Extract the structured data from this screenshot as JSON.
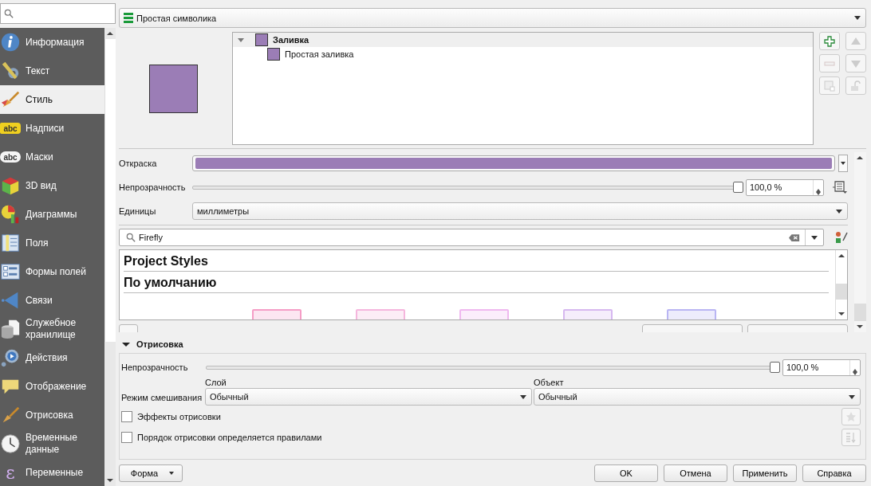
{
  "sidebar": {
    "items": [
      {
        "label": "Информация",
        "selected": false
      },
      {
        "label": "Текст",
        "selected": false
      },
      {
        "label": "Стиль",
        "selected": true
      },
      {
        "label": "Надписи",
        "selected": false,
        "badge": "abc"
      },
      {
        "label": "Маски",
        "selected": false,
        "badge": "abc"
      },
      {
        "label": "3D вид",
        "selected": false
      },
      {
        "label": "Диаграммы",
        "selected": false
      },
      {
        "label": "Поля",
        "selected": false
      },
      {
        "label": "Формы полей",
        "selected": false
      },
      {
        "label": "Связи",
        "selected": false
      },
      {
        "label": "Служебное хранилище",
        "selected": false
      },
      {
        "label": "Действия",
        "selected": false
      },
      {
        "label": "Отображение",
        "selected": false
      },
      {
        "label": "Отрисовка",
        "selected": false
      },
      {
        "label": "Временные данные",
        "selected": false
      },
      {
        "label": "Переменные",
        "selected": false,
        "badge": "ε"
      }
    ]
  },
  "renderer": {
    "value": "Простая символика"
  },
  "symbol_tree": {
    "expanded": true,
    "label": "Заливка",
    "children": [
      {
        "label": "Простая заливка"
      }
    ]
  },
  "properties": {
    "color_label": "Откраска",
    "opacity_label": "Непрозрачность",
    "opacity": {
      "level": 1
    },
    "opacity_value": "100,0 %",
    "units_label": "Единицы",
    "units_value": "миллиметры"
  },
  "style_library": {
    "search_value": "Firefly",
    "groups": [
      "Project Styles",
      "По умолчанию"
    ],
    "swatches": [
      {
        "color": "#f59dc6"
      },
      {
        "color": "#f5b6dd"
      },
      {
        "color": "#efb8ef"
      },
      {
        "color": "#d6b8f0"
      },
      {
        "color": "#b9b5f3"
      }
    ]
  },
  "rendering": {
    "title": "Отрисовка",
    "expanded": true,
    "opacity_label": "Непрозрачность",
    "opacity": {
      "level": 1
    },
    "opacity_value": "100,0 %",
    "blend_label": "Режим смешивания",
    "layer_label": "Слой",
    "layer_value": "Обычный",
    "object_label": "Объект",
    "object_value": "Обычный",
    "checks": [
      {
        "label": "Эффекты отрисовки",
        "checked": false
      },
      {
        "label": "Порядок отрисовки определяется правилами",
        "checked": false
      }
    ]
  },
  "buttons": {
    "style_menu": "Форма",
    "actions": [
      "OK",
      "Отмена",
      "Применить",
      "Справка"
    ]
  }
}
